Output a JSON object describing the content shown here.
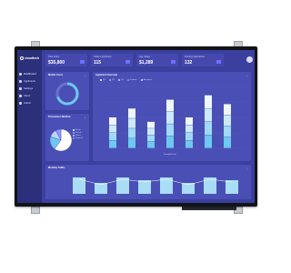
{
  "app": {
    "name": "cloudtech"
  },
  "sidebar": {
    "items": [
      {
        "label": "Dashboard",
        "icon": "dashboard-icon"
      },
      {
        "label": "Applicants",
        "icon": "people-icon"
      },
      {
        "label": "Settings",
        "icon": "gear-icon"
      },
      {
        "label": "Users",
        "icon": "user-icon"
      },
      {
        "label": "Admin",
        "icon": "shield-icon"
      }
    ]
  },
  "stats": [
    {
      "label": "Total Visitor",
      "value": "$35,800"
    },
    {
      "label": "Today's Applicants",
      "value": "115"
    },
    {
      "label": "Avg. Salary",
      "value": "$1,289"
    },
    {
      "label": "Pending Applications",
      "value": "132"
    }
  ],
  "cards": {
    "mobile": {
      "title": "Mobile Users"
    },
    "applicant": {
      "title": "Applicant Overview",
      "xlabel": "Position/Level",
      "legend": [
        "Q1",
        "Q2",
        "Q3",
        "Position",
        "Accepted"
      ]
    },
    "promotion": {
      "title": "Promotions Method",
      "legend": [
        "Email",
        "Social",
        "Direct",
        "Referral"
      ]
    },
    "monthly": {
      "title": "Monthly Traffic"
    }
  },
  "colors": {
    "accent": "#6ec8f0",
    "panel": "#4a4fb5",
    "screen": "#3b3f9e",
    "sidebar": "#2c2f7a"
  },
  "chart_data": [
    {
      "type": "bar",
      "title": "Applicant Overview",
      "xlabel": "Position/Level",
      "series": [
        {
          "values": [
            7,
            9,
            6,
            11,
            7,
            12,
            10
          ]
        }
      ]
    },
    {
      "type": "pie",
      "title": "Promotions Method",
      "categories": [
        "Email",
        "Social",
        "Direct",
        "Referral"
      ],
      "values": [
        60,
        20,
        12,
        8
      ]
    },
    {
      "type": "bar",
      "title": "Monthly Traffic",
      "values": [
        6,
        4,
        6,
        5,
        6,
        4,
        6,
        5
      ]
    }
  ]
}
